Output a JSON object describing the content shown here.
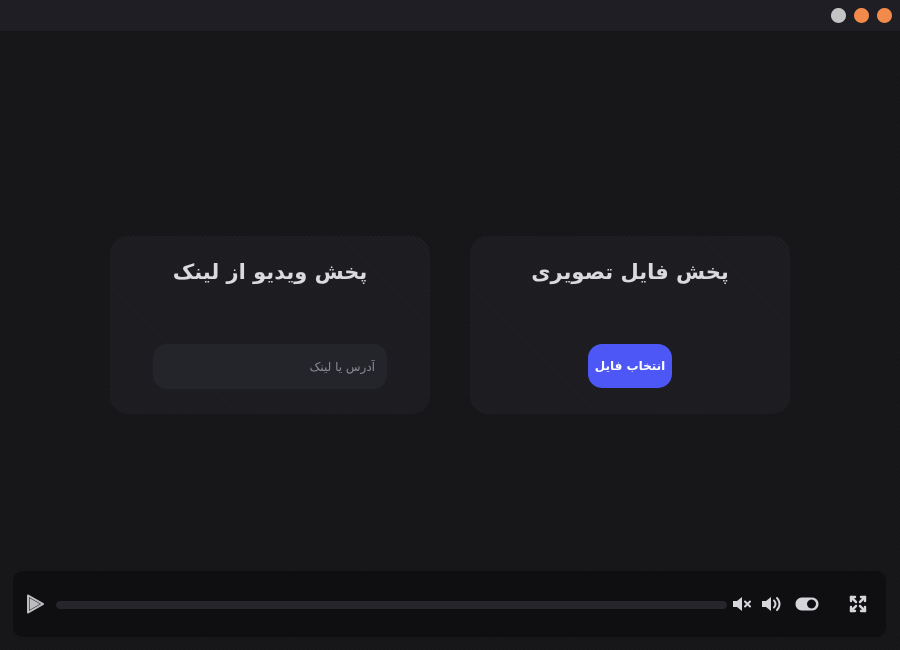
{
  "window": {
    "controls": [
      {
        "name": "minimize",
        "color": "#c4c4c4"
      },
      {
        "name": "maximize",
        "color": "#f28a4c"
      },
      {
        "name": "close",
        "color": "#f28a4c"
      }
    ]
  },
  "image_card": {
    "title": "پخش فایل تصویری",
    "button_label": "انتخاب فایل",
    "button_color": "#4c57f5"
  },
  "link_card": {
    "title": "پخش ویدیو از لینک",
    "input_placeholder": "آدرس یا لینک",
    "input_value": ""
  },
  "player": {
    "progress": 0,
    "icons": [
      "play-icon",
      "mute-icon",
      "volume-icon",
      "toggle-switch",
      "fullscreen-icon"
    ]
  }
}
